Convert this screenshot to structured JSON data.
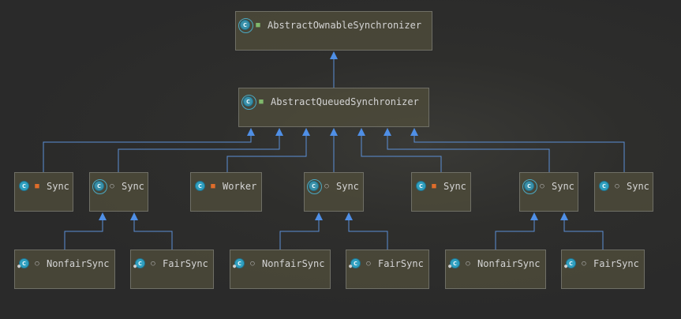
{
  "nodes": [
    {
      "id": "aos",
      "label": "AbstractOwnableSynchronizer",
      "kind": "abstract",
      "modifier": "lock-open"
    },
    {
      "id": "aqs",
      "label": "AbstractQueuedSynchronizer",
      "kind": "abstract",
      "modifier": "lock-open"
    },
    {
      "id": "s1",
      "label": "Sync",
      "kind": "class",
      "modifier": "lock"
    },
    {
      "id": "s2",
      "label": "Sync",
      "kind": "abstract",
      "modifier": "pkg"
    },
    {
      "id": "wk",
      "label": "Worker",
      "kind": "class",
      "modifier": "lock"
    },
    {
      "id": "s3",
      "label": "Sync",
      "kind": "abstract",
      "modifier": "pkg"
    },
    {
      "id": "s4",
      "label": "Sync",
      "kind": "class",
      "modifier": "lock"
    },
    {
      "id": "s5",
      "label": "Sync",
      "kind": "abstract",
      "modifier": "pkg"
    },
    {
      "id": "s6",
      "label": "Sync",
      "kind": "class",
      "modifier": "pkg"
    },
    {
      "id": "nf1",
      "label": "NonfairSync",
      "kind": "class",
      "modifier": "pkg"
    },
    {
      "id": "f1",
      "label": "FairSync",
      "kind": "class",
      "modifier": "pkg"
    },
    {
      "id": "nf2",
      "label": "NonfairSync",
      "kind": "class",
      "modifier": "pkg"
    },
    {
      "id": "f2",
      "label": "FairSync",
      "kind": "class",
      "modifier": "pkg"
    },
    {
      "id": "nf3",
      "label": "NonfairSync",
      "kind": "class",
      "modifier": "pkg"
    },
    {
      "id": "f3",
      "label": "FairSync",
      "kind": "class",
      "modifier": "pkg"
    }
  ],
  "edges": [
    {
      "from": "aqs",
      "to": "aos"
    },
    {
      "from": "s1",
      "to": "aqs"
    },
    {
      "from": "s2",
      "to": "aqs"
    },
    {
      "from": "wk",
      "to": "aqs"
    },
    {
      "from": "s3",
      "to": "aqs"
    },
    {
      "from": "s4",
      "to": "aqs"
    },
    {
      "from": "s5",
      "to": "aqs"
    },
    {
      "from": "s6",
      "to": "aqs"
    },
    {
      "from": "nf1",
      "to": "s2"
    },
    {
      "from": "f1",
      "to": "s2"
    },
    {
      "from": "nf2",
      "to": "s3"
    },
    {
      "from": "f2",
      "to": "s3"
    },
    {
      "from": "nf3",
      "to": "s5"
    },
    {
      "from": "f3",
      "to": "s5"
    }
  ],
  "colors": {
    "edge": "#5b8fd6",
    "arrow": "#4f8fe6"
  }
}
